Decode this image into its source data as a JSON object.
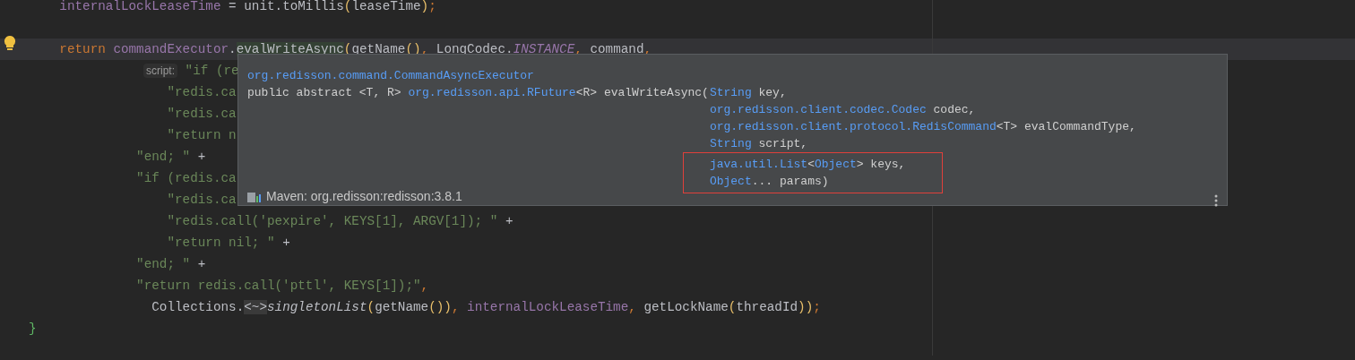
{
  "code_lines": [
    {
      "kind": "code",
      "current": false,
      "tokens": [
        {
          "text": "    internalLockLeaseTime",
          "kind": "field"
        },
        {
          "text": " = unit.toMillis",
          "kind": "plain"
        },
        {
          "text": "(",
          "kind": "paren"
        },
        {
          "text": "leaseTime",
          "kind": "plain"
        },
        {
          "text": ")",
          "kind": "paren"
        },
        {
          "text": ";",
          "kind": "keyword"
        }
      ]
    },
    {
      "kind": "blank"
    },
    {
      "kind": "code",
      "current": true,
      "tokens": [
        {
          "text": "    return ",
          "kind": "keyword"
        },
        {
          "text": "commandExecutor",
          "kind": "field"
        },
        {
          "text": ".",
          "kind": "plain"
        },
        {
          "text": "evalWriteAsync",
          "kind": "highlighted"
        },
        {
          "text": "(",
          "kind": "paren"
        },
        {
          "text": "getName",
          "kind": "plain"
        },
        {
          "text": "()",
          "kind": "paren"
        },
        {
          "text": ", ",
          "kind": "keyword"
        },
        {
          "text": "LongCodec.",
          "kind": "plain"
        },
        {
          "text": "INSTANCE",
          "kind": "static_field"
        },
        {
          "text": ", ",
          "kind": "keyword"
        },
        {
          "text": "command",
          "kind": "plain"
        },
        {
          "text": ",",
          "kind": "keyword"
        }
      ]
    },
    {
      "kind": "code",
      "current": false,
      "tokens": [
        {
          "text": "script:",
          "kind": "hint"
        },
        {
          "text": " \"if (re",
          "kind": "string"
        }
      ]
    },
    {
      "kind": "code",
      "current": false,
      "tokens": [
        {
          "text": "                  \"redis.ca",
          "kind": "string"
        }
      ]
    },
    {
      "kind": "code",
      "current": false,
      "tokens": [
        {
          "text": "                  \"redis.ca",
          "kind": "string"
        }
      ]
    },
    {
      "kind": "code",
      "current": false,
      "tokens": [
        {
          "text": "                  \"return n",
          "kind": "string"
        }
      ]
    },
    {
      "kind": "code",
      "current": false,
      "tokens": [
        {
          "text": "              \"end; \"",
          "kind": "string"
        },
        {
          "text": " +",
          "kind": "plain"
        }
      ]
    },
    {
      "kind": "code",
      "current": false,
      "tokens": [
        {
          "text": "              \"if (redis.ca",
          "kind": "string"
        }
      ]
    },
    {
      "kind": "code",
      "current": false,
      "tokens": [
        {
          "text": "                  \"redis.ca",
          "kind": "string"
        }
      ]
    },
    {
      "kind": "code",
      "current": false,
      "tokens": [
        {
          "text": "                  \"redis.call('pexpire', KEYS[1], ARGV[1]); \"",
          "kind": "string"
        },
        {
          "text": " +",
          "kind": "plain"
        }
      ]
    },
    {
      "kind": "code",
      "current": false,
      "tokens": [
        {
          "text": "                  \"return nil; \"",
          "kind": "string"
        },
        {
          "text": " +",
          "kind": "plain"
        }
      ]
    },
    {
      "kind": "code",
      "current": false,
      "tokens": [
        {
          "text": "              \"end; \"",
          "kind": "string"
        },
        {
          "text": " +",
          "kind": "plain"
        }
      ]
    },
    {
      "kind": "code",
      "current": false,
      "tokens": [
        {
          "text": "              \"return redis.call('pttl', KEYS[1]);\"",
          "kind": "string"
        },
        {
          "text": ",",
          "kind": "keyword"
        }
      ]
    },
    {
      "kind": "code",
      "current": false,
      "tokens": [
        {
          "text": "                Collections.",
          "kind": "plain"
        },
        {
          "text": "<~>",
          "kind": "fold"
        },
        {
          "text": "singletonList",
          "kind": "method_italic"
        },
        {
          "text": "(",
          "kind": "paren"
        },
        {
          "text": "getName",
          "kind": "plain"
        },
        {
          "text": "())",
          "kind": "paren"
        },
        {
          "text": ", ",
          "kind": "keyword"
        },
        {
          "text": "internalLockLeaseTime",
          "kind": "field"
        },
        {
          "text": ", ",
          "kind": "keyword"
        },
        {
          "text": "getLockName",
          "kind": "plain"
        },
        {
          "text": "(",
          "kind": "paren"
        },
        {
          "text": "threadId",
          "kind": "plain"
        },
        {
          "text": "))",
          "kind": "paren"
        },
        {
          "text": ";",
          "kind": "keyword"
        }
      ]
    },
    {
      "kind": "code",
      "current": false,
      "tokens": [
        {
          "text": "}",
          "kind": "brace"
        }
      ]
    }
  ],
  "doc_popup": {
    "class_name": "org.redisson.command.CommandAsyncExecutor",
    "signature": [
      {
        "text": "public abstract <T, R> ",
        "kind": "plain"
      },
      {
        "text": "org.redisson.api.RFuture",
        "kind": "link"
      },
      {
        "text": "<R> evalWriteAsync(",
        "kind": "plain"
      }
    ],
    "params": [
      {
        "highlighted": false,
        "tokens": [
          {
            "text": "String",
            "kind": "link"
          },
          {
            "text": " key,",
            "kind": "plain"
          }
        ]
      },
      {
        "highlighted": false,
        "tokens": [
          {
            "text": "org.redisson.client.codec.Codec",
            "kind": "link"
          },
          {
            "text": " codec,",
            "kind": "plain"
          }
        ]
      },
      {
        "highlighted": false,
        "tokens": [
          {
            "text": "org.redisson.client.protocol.RedisCommand",
            "kind": "link"
          },
          {
            "text": "<T> evalCommandType,",
            "kind": "plain"
          }
        ]
      },
      {
        "highlighted": false,
        "tokens": [
          {
            "text": "String",
            "kind": "link"
          },
          {
            "text": " script,",
            "kind": "plain"
          }
        ]
      },
      {
        "highlighted": true,
        "tokens": [
          {
            "text": "java.util.List",
            "kind": "link"
          },
          {
            "text": "<",
            "kind": "plain"
          },
          {
            "text": "Object",
            "kind": "link"
          },
          {
            "text": "> keys,",
            "kind": "plain"
          }
        ]
      },
      {
        "highlighted": true,
        "tokens": [
          {
            "text": "Object",
            "kind": "link"
          },
          {
            "text": "... params)",
            "kind": "plain"
          }
        ]
      }
    ],
    "source": "Maven: org.redisson:redisson:3.8.1"
  }
}
